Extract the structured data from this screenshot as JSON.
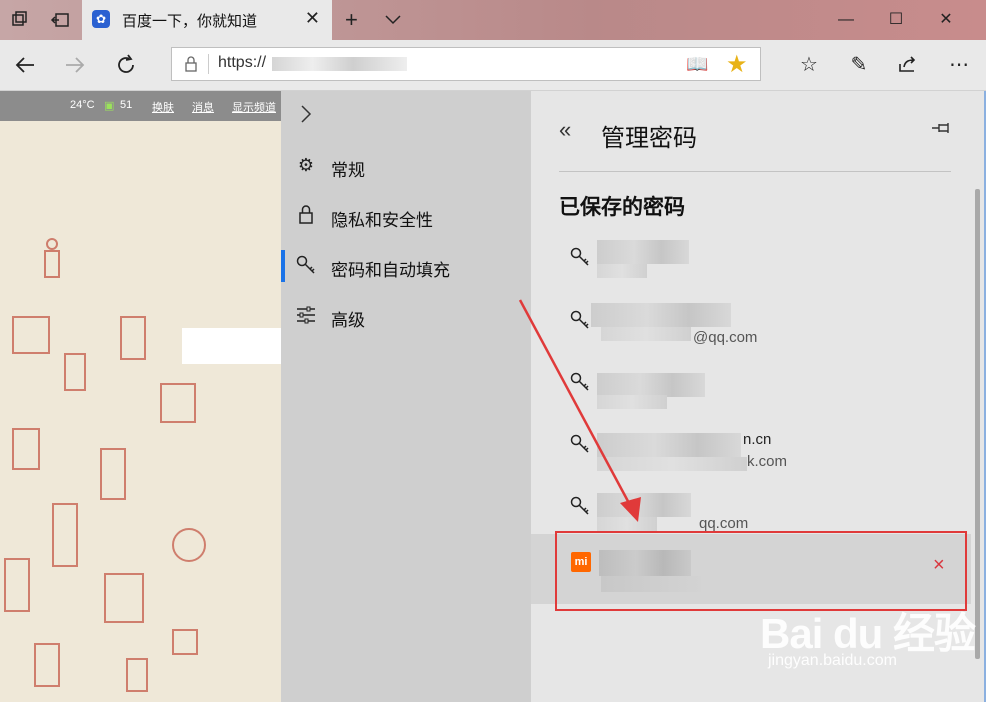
{
  "browser": {
    "tab_title": "百度一下，你就知道",
    "tab_favicon": "baidu-paw-icon",
    "address_prefix": "https://",
    "colors": {
      "accent": "#1a73e8",
      "star": "#e8b217",
      "danger": "#d9363e",
      "annotation": "#e03a3a"
    }
  },
  "page": {
    "weather_temp": "24°C",
    "aqi": "51",
    "links": [
      "换肤",
      "消息",
      "显示频道"
    ]
  },
  "settings": {
    "nav": [
      {
        "label": "常规",
        "icon": "gear-icon"
      },
      {
        "label": "隐私和安全性",
        "icon": "lock-icon"
      },
      {
        "label": "密码和自动填充",
        "icon": "key-icon",
        "active": true
      },
      {
        "label": "高级",
        "icon": "sliders-icon"
      }
    ],
    "panel_title": "管理密码",
    "section_title": "已保存的密码",
    "saved_passwords": [
      {
        "site": "",
        "icon": "key-icon"
      },
      {
        "site": "@qq.com",
        "icon": "key-icon"
      },
      {
        "site": "",
        "icon": "key-icon"
      },
      {
        "site": "n.cn",
        "site2": "k.com",
        "icon": "key-icon"
      },
      {
        "site": "qq.com",
        "icon": "key-icon"
      }
    ],
    "selected_entry": {
      "icon": "mi-logo-icon",
      "icon_text": "mi",
      "delete": "×"
    }
  },
  "watermark": {
    "logo": "Bai du 经验",
    "url": "jingyan.baidu.com"
  }
}
